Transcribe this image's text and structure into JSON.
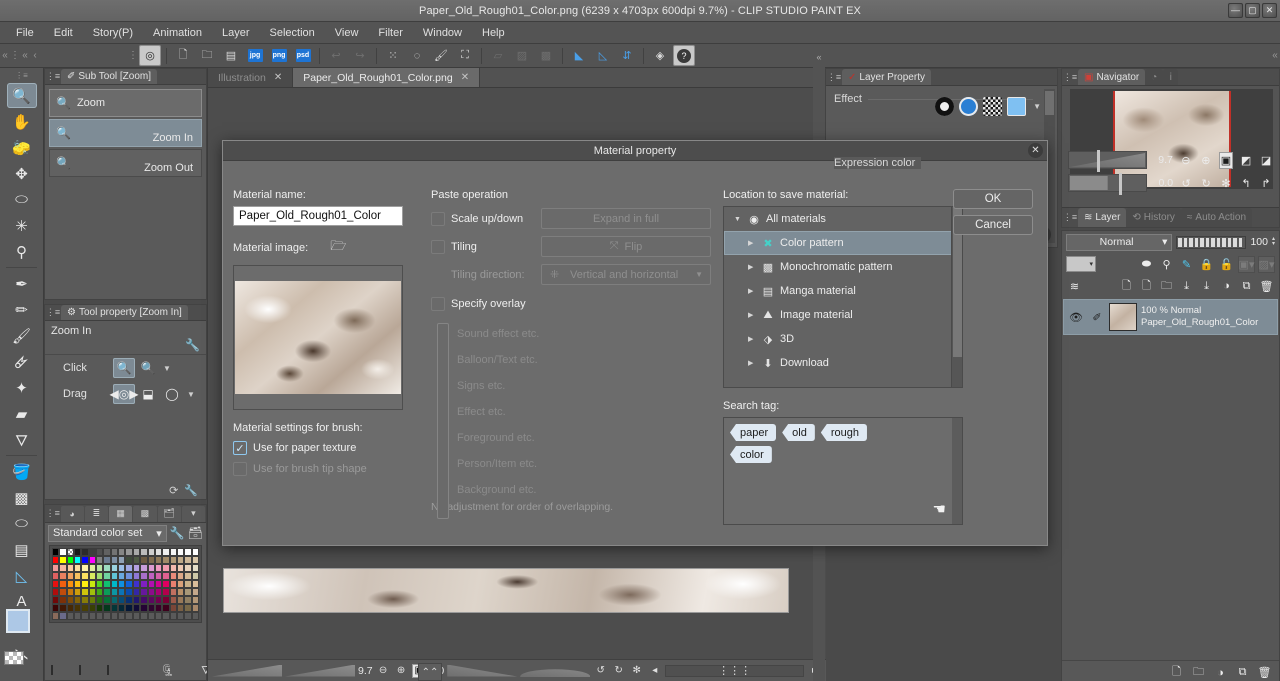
{
  "titlebar": {
    "title": "Paper_Old_Rough01_Color.png (6239 x 4703px 600dpi 9.7%)  - CLIP STUDIO PAINT EX",
    "minimize": "—",
    "maximize": "▢",
    "close": "✕"
  },
  "menubar": {
    "items": [
      "File",
      "Edit",
      "Story(P)",
      "Animation",
      "Layer",
      "Selection",
      "View",
      "Filter",
      "Window",
      "Help"
    ]
  },
  "commandbar": {
    "icons": [
      {
        "name": "clip-studio-logo-icon",
        "glyph": "◎"
      },
      {
        "name": "new-file-icon",
        "glyph": "🗋"
      },
      {
        "name": "open-file-icon",
        "glyph": "🗀"
      },
      {
        "name": "save-icon",
        "glyph": "▤"
      },
      {
        "name": "export-jpg-icon",
        "glyph": "jpg"
      },
      {
        "name": "export-png-icon",
        "glyph": "png"
      },
      {
        "name": "export-psd-icon",
        "glyph": "psd"
      },
      {
        "name": "undo-icon",
        "glyph": "↩"
      },
      {
        "name": "redo-icon",
        "glyph": "↪"
      },
      {
        "name": "delete-selection-icon",
        "glyph": "⁙"
      },
      {
        "name": "fill-selection-icon",
        "glyph": "◌"
      },
      {
        "name": "fill-icon",
        "glyph": "🖌"
      },
      {
        "name": "scale-rotate-icon",
        "glyph": "⛶"
      },
      {
        "name": "select-all-icon",
        "glyph": "▱"
      },
      {
        "name": "deselect-icon",
        "glyph": "▨"
      },
      {
        "name": "invert-selection-icon",
        "glyph": "▩"
      },
      {
        "name": "ruler-snap-icon",
        "glyph": "◣"
      },
      {
        "name": "snap-special-ruler-icon",
        "glyph": "◺"
      },
      {
        "name": "snap-grid-icon",
        "glyph": "⇵"
      },
      {
        "name": "clip-studio-icon",
        "glyph": "◈"
      },
      {
        "name": "help-icon",
        "glyph": "?"
      }
    ]
  },
  "toolbar": {
    "tools": [
      {
        "name": "zoom-tool",
        "glyph": "🔍",
        "selected": true
      },
      {
        "name": "hand-tool",
        "glyph": "✋",
        "selected": false
      },
      {
        "name": "rotate-tool",
        "glyph": "🧽",
        "selected": false
      },
      {
        "name": "move-tool",
        "glyph": "✥",
        "selected": false
      },
      {
        "name": "operation-tool",
        "glyph": "⬭",
        "selected": false
      },
      {
        "name": "object-tool",
        "glyph": "✳",
        "selected": false
      },
      {
        "name": "eyedropper-tool",
        "glyph": "⚲",
        "selected": false
      },
      {
        "name": "pen-tool",
        "glyph": "✒",
        "selected": false
      },
      {
        "name": "pencil-tool",
        "glyph": "✏",
        "selected": false
      },
      {
        "name": "brush-tool",
        "glyph": "🖌",
        "selected": false
      },
      {
        "name": "airbrush-tool",
        "glyph": "🜸",
        "selected": false
      },
      {
        "name": "decoration-tool",
        "glyph": "✦",
        "selected": false
      },
      {
        "name": "eraser-tool",
        "glyph": "▰",
        "selected": false
      },
      {
        "name": "blend-tool",
        "glyph": "🜄",
        "selected": false
      },
      {
        "name": "fill-tool",
        "glyph": "🪣",
        "selected": false
      },
      {
        "name": "gradient-tool",
        "glyph": "▩",
        "selected": false
      },
      {
        "name": "figure-tool",
        "glyph": "⬭",
        "selected": false
      },
      {
        "name": "frame-border-tool",
        "glyph": "▤",
        "selected": false
      },
      {
        "name": "ruler-tool",
        "glyph": "◺",
        "selected": false
      },
      {
        "name": "text-tool",
        "glyph": "A",
        "selected": false
      },
      {
        "name": "balloon-tool",
        "glyph": "➴",
        "selected": false
      },
      {
        "name": "correct-line-tool",
        "glyph": "⋋",
        "selected": false
      }
    ]
  },
  "subtool_panel": {
    "tab_label": "Sub Tool [Zoom]",
    "header_item": "Zoom",
    "items": [
      {
        "label": "Zoom In",
        "selected": true
      },
      {
        "label": "Zoom Out",
        "selected": false
      }
    ]
  },
  "tool_property_panel": {
    "tab_label": "Tool property [Zoom In]",
    "tool_name": "Zoom In",
    "rows": [
      {
        "label": "Click"
      },
      {
        "label": "Drag"
      }
    ]
  },
  "color_set_panel": {
    "selected_set": "Standard color set"
  },
  "document_tabs": {
    "tabs": [
      {
        "label": "Illustration",
        "active": false
      },
      {
        "label": "Paper_Old_Rough01_Color.png",
        "active": true
      }
    ]
  },
  "canvas_status": {
    "zoom": "9.7",
    "rotation": "0.0"
  },
  "layer_property_panel": {
    "tab_label": "Layer Property",
    "sections": [
      "Effect",
      "Expression color"
    ]
  },
  "navigator_panel": {
    "tab_label": "Navigator",
    "zoom": "9.7",
    "rotation": "0.0",
    "bottom_tabs": [
      {
        "label": "Layer",
        "active": true
      },
      {
        "label": "History",
        "active": false
      },
      {
        "label": "Auto Action",
        "active": false
      }
    ]
  },
  "layer_panel": {
    "blend_mode": "Normal",
    "opacity": "100",
    "layers": [
      {
        "meta1": "100 % Normal",
        "meta2": "Paper_Old_Rough01_Color",
        "selected": true
      }
    ]
  },
  "dialog": {
    "title": "Material property",
    "close_glyph": "✕",
    "material_name_label": "Material name:",
    "material_name_value": "Paper_Old_Rough01_Color",
    "material_image_label": "Material image:",
    "brush_settings_label": "Material settings for brush:",
    "checkbox_paper_texture": "Use for paper texture",
    "checkbox_brush_tip": "Use for brush tip shape",
    "paste_operation_label": "Paste operation",
    "scale_updown_label": "Scale up/down",
    "expand_in_full_label": "Expand in full",
    "tiling_label": "Tiling",
    "flip_label": "Flip",
    "tiling_direction_label": "Tiling direction:",
    "tiling_direction_value": "Vertical and horizontal",
    "specify_overlay_label": "Specify overlay",
    "overlay_items": [
      "Sound effect etc.",
      "Balloon/Text etc.",
      "Signs etc.",
      "Effect etc.",
      "Foreground etc.",
      "Person/Item etc.",
      "Background etc."
    ],
    "overlay_note": "No adjustment for order of overlapping.",
    "location_label": "Location to save material:",
    "location_tree": [
      {
        "label": "All materials",
        "level": 0,
        "selected": false,
        "icon": "radio-icon",
        "glyph": "◉",
        "arrow": "▼"
      },
      {
        "label": "Color pattern",
        "level": 1,
        "selected": true,
        "icon": "color-pattern-icon",
        "glyph": "✖",
        "arrow": "▶"
      },
      {
        "label": "Monochromatic pattern",
        "level": 1,
        "selected": false,
        "icon": "monochromatic-pattern-icon",
        "glyph": "▩",
        "arrow": "▶"
      },
      {
        "label": "Manga material",
        "level": 1,
        "selected": false,
        "icon": "manga-material-icon",
        "glyph": "▤",
        "arrow": "▶"
      },
      {
        "label": "Image material",
        "level": 1,
        "selected": false,
        "icon": "image-material-icon",
        "glyph": "⛰",
        "arrow": "▶"
      },
      {
        "label": "3D",
        "level": 1,
        "selected": false,
        "icon": "three-d-icon",
        "glyph": "⬗",
        "arrow": "▶"
      },
      {
        "label": "Download",
        "level": 1,
        "selected": false,
        "icon": "download-icon",
        "glyph": "⬇",
        "arrow": "▶"
      }
    ],
    "search_tag_label": "Search tag:",
    "tags": [
      "paper",
      "old",
      "rough",
      "color"
    ],
    "ok_label": "OK",
    "cancel_label": "Cancel"
  },
  "colors": {
    "window_bg": "#4a4a4a",
    "panel_bg": "#5a5a5a",
    "dialog_bg": "#6c6c6c",
    "selection_blue": "#7e8c96",
    "accent_blue": "#1e74d4",
    "tag_bg": "#dfe9f3",
    "text": "#e8e8e8"
  }
}
